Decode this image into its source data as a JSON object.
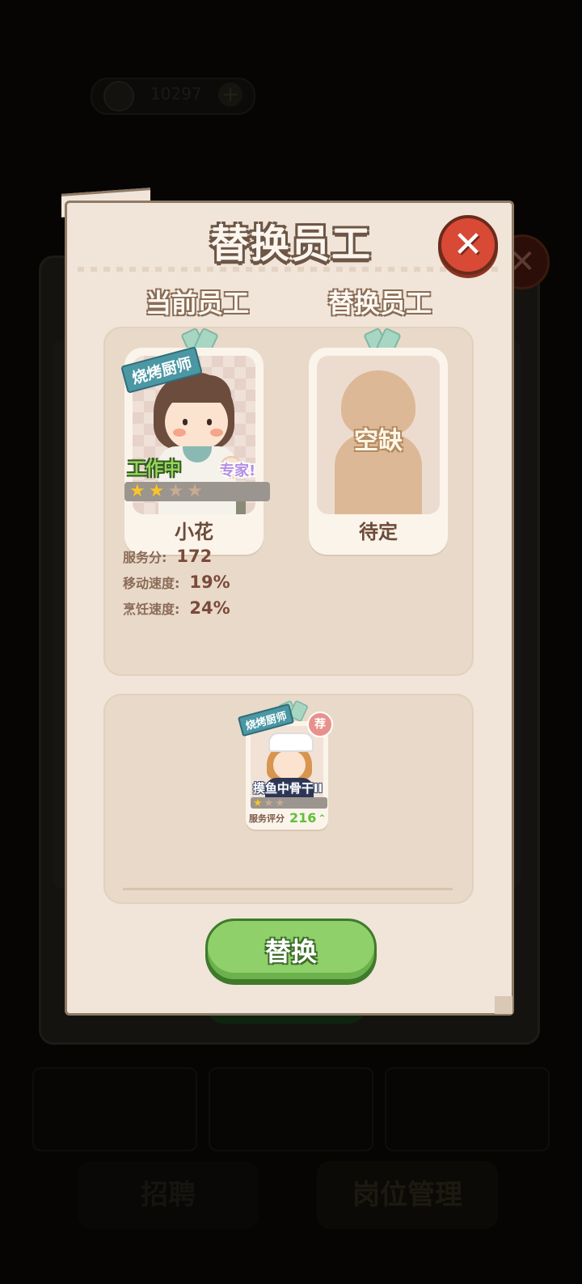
{
  "background": {
    "coins_text": "10297",
    "plus_symbol": "+",
    "bottom_buttons": [
      "招聘",
      "岗位管理"
    ]
  },
  "dialog": {
    "title": "替换员工",
    "close_symbol": "✕",
    "current_header": "当前员工",
    "replacement_header": "替换员工",
    "current_employee": {
      "role_tag": "烧烤厨师",
      "status": "工作中",
      "badge": "专家!",
      "name": "小花",
      "stars_total": 4,
      "stars_filled": 2
    },
    "replacement_slot": {
      "empty_label": "空缺",
      "name": "待定"
    },
    "stats": [
      {
        "label": "服务分:",
        "value": "172"
      },
      {
        "label": "移动速度:",
        "value": "19%"
      },
      {
        "label": "烹饪速度:",
        "value": "24%"
      }
    ],
    "candidates": [
      {
        "role_tag": "烧烤厨师",
        "recommend_badge": "荐",
        "status": "摸鱼中骨干II",
        "stars_total": 3,
        "stars_filled": 1,
        "score_label": "服务评分",
        "score_value": "216",
        "score_trend_icon": "up-arrow-icon"
      }
    ],
    "confirm_button_label": "替换"
  },
  "colors": {
    "dialog_bg": "#f0e5d8",
    "close_red": "#d84a36",
    "confirm_green": "#8fd06a",
    "score_green": "#5fbf3a",
    "role_teal": "#4b97a4"
  }
}
